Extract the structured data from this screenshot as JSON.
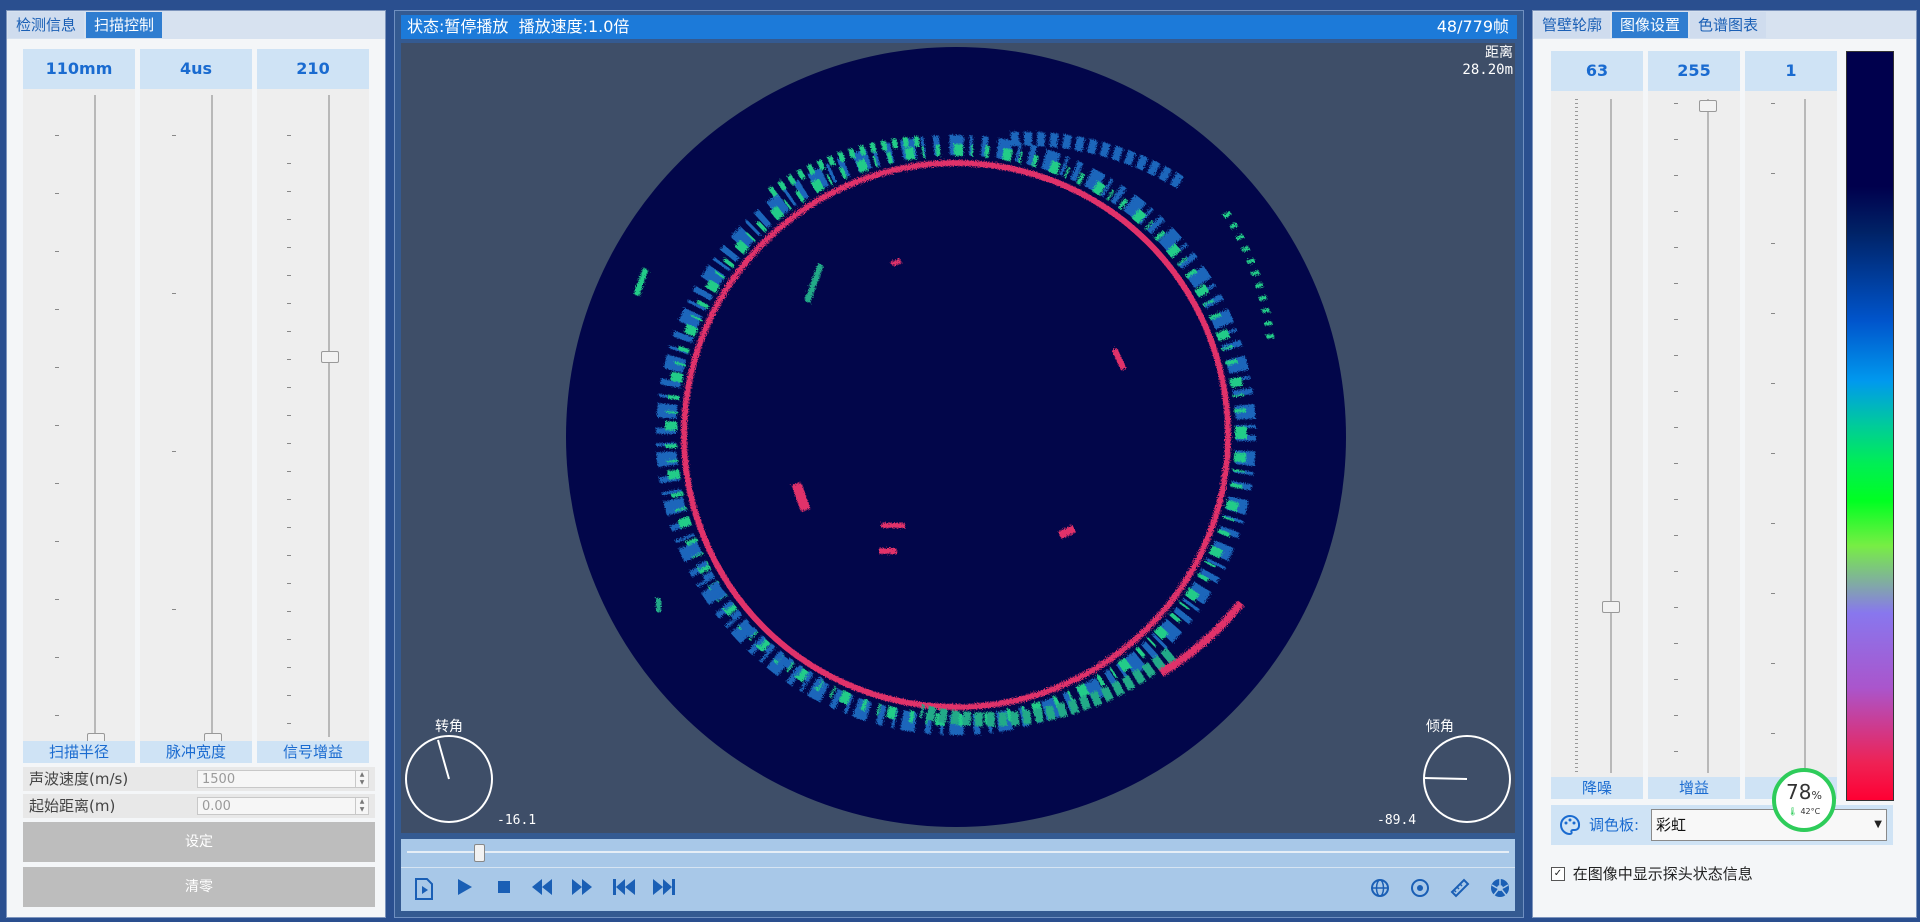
{
  "left": {
    "tabs": [
      "检测信息",
      "扫描控制"
    ],
    "sliders": [
      {
        "value": "110mm",
        "label": "扫描半径"
      },
      {
        "value": "4us",
        "label": "脉冲宽度"
      },
      {
        "value": "210",
        "label": "信号增益"
      }
    ],
    "fields": [
      {
        "label": "声波速度(m/s)",
        "value": "1500"
      },
      {
        "label": "起始距离(m)",
        "value": "0.00"
      }
    ],
    "buttons": {
      "set": "设定",
      "clear": "清零"
    }
  },
  "center": {
    "status": "状态:暂停播放",
    "speed": "播放速度:1.0倍",
    "frame": "48/779帧",
    "distance_label": "距离",
    "distance_value": "28.20m",
    "rotation_label": "转角",
    "rotation_value": "-16.1",
    "tilt_label": "倾角",
    "tilt_value": "-89.4",
    "playback_progress": 0.065
  },
  "right": {
    "tabs": [
      "管壁轮廓",
      "图像设置",
      "色谱图表"
    ],
    "sliders": [
      {
        "value": "63",
        "label": "降噪"
      },
      {
        "value": "255",
        "label": "增益"
      },
      {
        "value": "1",
        "label": ""
      }
    ],
    "palette_label": "调色板:",
    "palette_value": "彩虹",
    "checkbox_label": "在图像中显示探头状态信息",
    "checkbox_checked": true,
    "badge_percent": "78",
    "badge_unit": "%",
    "badge_temp": "42°C"
  },
  "colors": {
    "accent": "#1c7ad9",
    "ring": "#e0306a",
    "background": "#02064a"
  }
}
